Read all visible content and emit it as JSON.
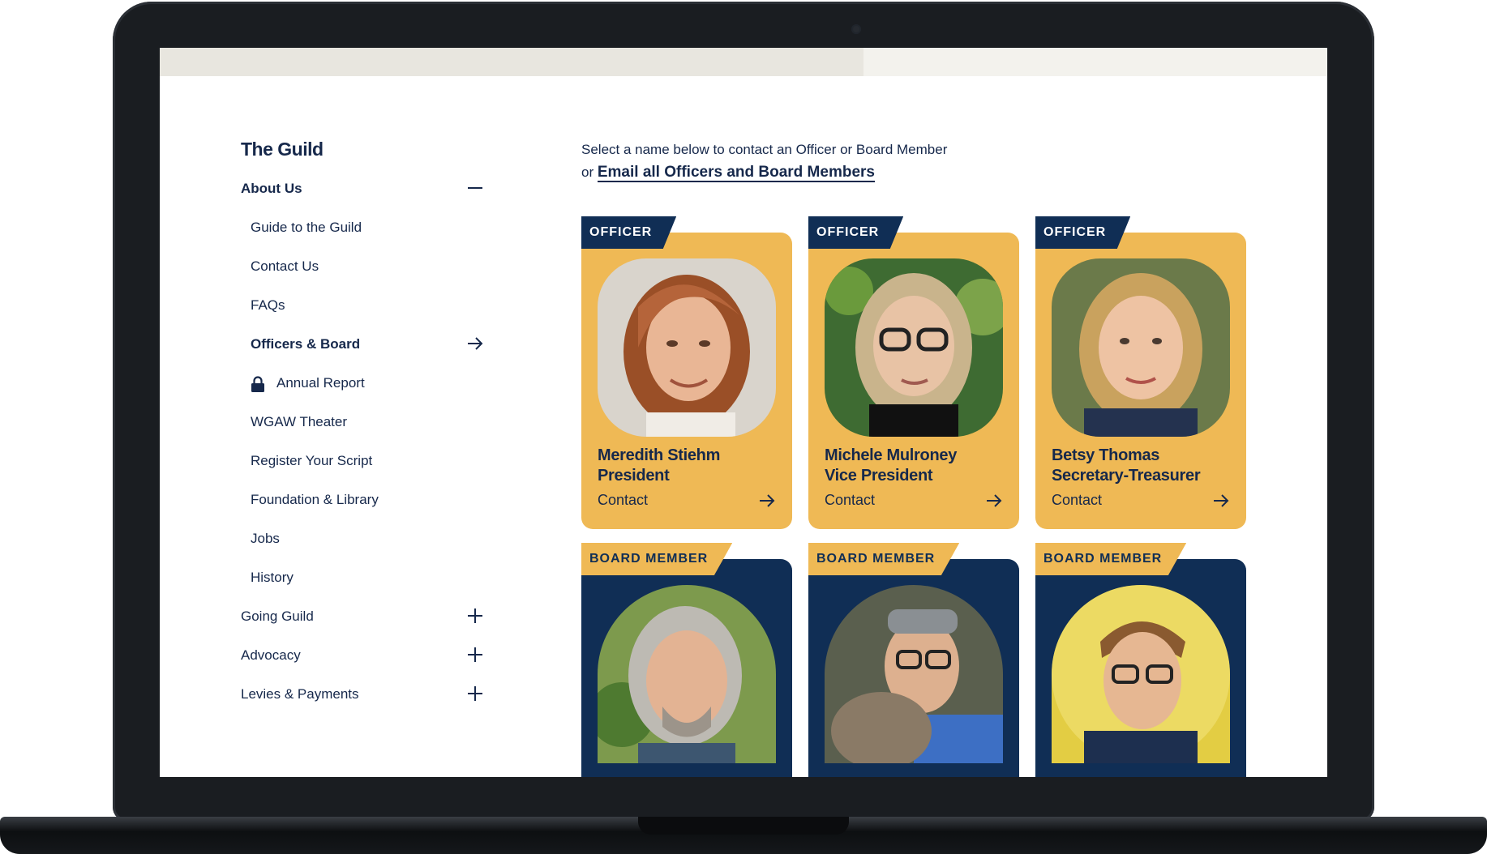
{
  "nav": {
    "title": "The Guild",
    "about_us": "About Us",
    "items": [
      {
        "label": "Guide to the Guild"
      },
      {
        "label": "Contact Us"
      },
      {
        "label": "FAQs"
      },
      {
        "label": "Officers & Board",
        "active": true
      },
      {
        "label": "Annual Report",
        "icon": "lock-icon"
      },
      {
        "label": "WGAW Theater"
      },
      {
        "label": "Register Your Script"
      },
      {
        "label": "Foundation & Library"
      },
      {
        "label": "Jobs"
      },
      {
        "label": "History"
      }
    ],
    "sections": [
      {
        "label": "Going Guild"
      },
      {
        "label": "Advocacy"
      },
      {
        "label": "Levies & Payments"
      }
    ]
  },
  "intro": {
    "line1": "Select a name below to contact an Officer or Board Member",
    "or_text": "or",
    "email_link": "Email all Officers and Board Members"
  },
  "officers": [
    {
      "tag": "OFFICER",
      "name": "Meredith Stiehm",
      "role": "President",
      "contact": "Contact"
    },
    {
      "tag": "OFFICER",
      "name": "Michele Mulroney",
      "role": "Vice President",
      "contact": "Contact"
    },
    {
      "tag": "OFFICER",
      "name": "Betsy Thomas",
      "role": "Secretary-Treasurer",
      "contact": "Contact"
    }
  ],
  "board": [
    {
      "tag": "BOARD MEMBER"
    },
    {
      "tag": "BOARD MEMBER"
    },
    {
      "tag": "BOARD MEMBER"
    }
  ],
  "colors": {
    "navy": "#102e55",
    "gold": "#efb955",
    "text": "#16284b"
  }
}
